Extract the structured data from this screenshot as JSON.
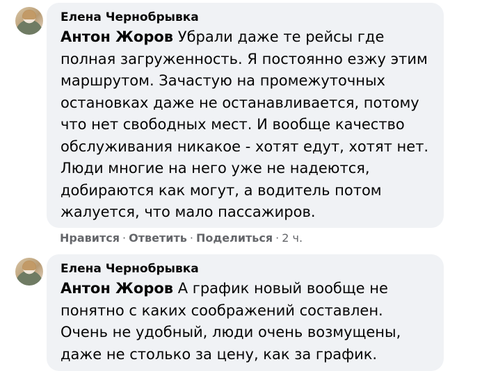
{
  "comments": [
    {
      "author": "Елена Чернобрывка",
      "mention": "Антон Жоров",
      "text": "Убрали даже те рейсы где полная загруженность. Я постоянно езжу этим маршрутом. Зачастую на промежуточных остановках даже не останавливается, потому что нет свободных мест. И вообще качество обслуживания никакое - хотят едут, хотят нет. Люди многие на него уже не надеются, добираются как могут, а водитель потом жалуется, что мало пассажиров.",
      "actions": {
        "like": "Нравится",
        "reply": "Ответить",
        "share": "Поделиться",
        "separator": "·",
        "time": "2 ч."
      }
    },
    {
      "author": "Елена Чернобрывка",
      "mention": "Антон Жоров",
      "text": "А график новый вообще не понятно с каких соображений составлен. Очень не удобный, люди очень возмущены, даже не столько за цену, как за график."
    }
  ]
}
